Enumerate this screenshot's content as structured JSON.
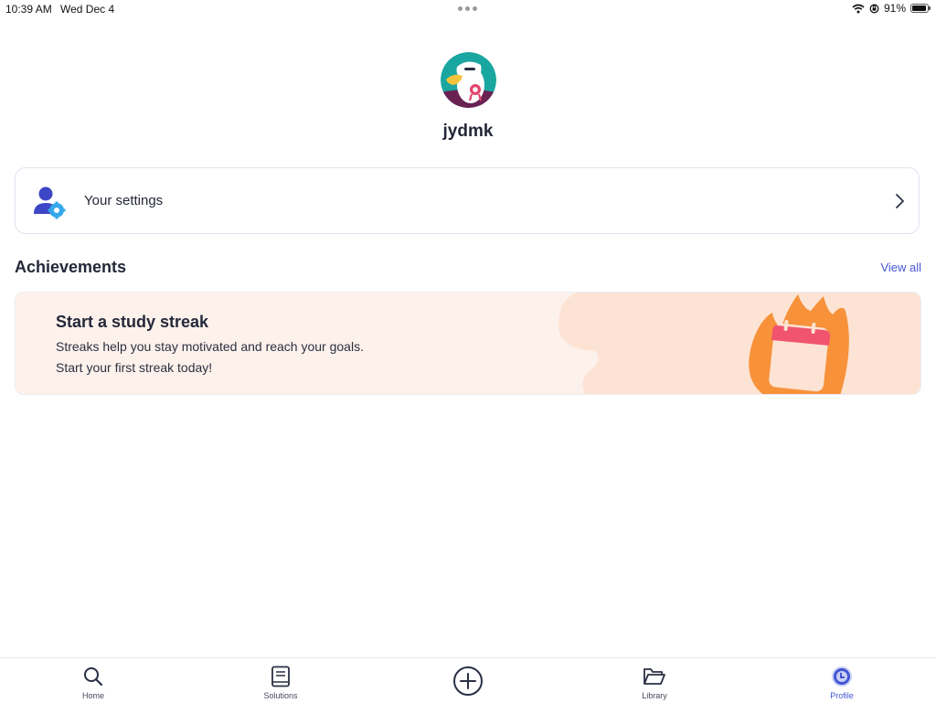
{
  "status_bar": {
    "time": "10:39 AM",
    "date": "Wed Dec 4",
    "battery_text": "91%",
    "battery_level": 0.91
  },
  "profile": {
    "username": "jydmk",
    "avatar_icon": "eagle-avatar-icon"
  },
  "settings": {
    "label": "Your settings",
    "icon": "user-gear-icon"
  },
  "achievements": {
    "title": "Achievements",
    "view_all": "View all",
    "streak_card": {
      "title": "Start a study streak",
      "line1": "Streaks help you stay motivated and reach your goals.",
      "line2": "Start your first streak today!",
      "illustration": "flame-calendar-icon"
    }
  },
  "tabbar": {
    "items": [
      {
        "label": "Home",
        "icon": "search-icon"
      },
      {
        "label": "Solutions",
        "icon": "book-icon"
      },
      {
        "label": "",
        "icon": "add-circle-icon"
      },
      {
        "label": "Library",
        "icon": "folder-icon"
      },
      {
        "label": "Profile",
        "icon": "profile-icon"
      }
    ],
    "active": "Profile"
  },
  "colors": {
    "accent": "#4255d4",
    "streak_bg": "#fdf1ec",
    "flame": "#f7923a",
    "calendar_top": "#f0546e"
  }
}
